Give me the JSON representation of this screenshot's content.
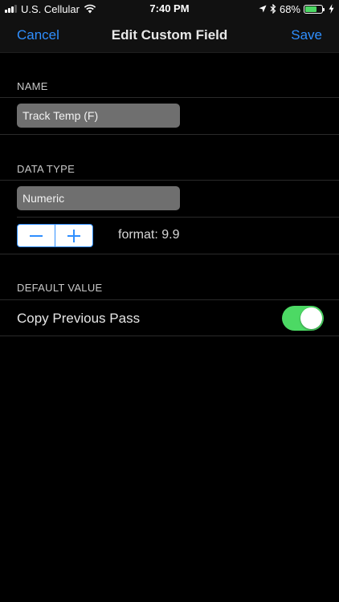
{
  "status_bar": {
    "carrier": "U.S. Cellular",
    "time": "7:40 PM",
    "battery_percent": "68%",
    "battery_level": 0.68,
    "icons": [
      "signal-icon",
      "wifi-icon",
      "location-arrow-icon",
      "bluetooth-icon",
      "battery-icon",
      "charging-bolt-icon"
    ]
  },
  "nav": {
    "cancel_label": "Cancel",
    "title": "Edit Custom Field",
    "save_label": "Save"
  },
  "name_section": {
    "header": "NAME",
    "field_value": "Track Temp (F)"
  },
  "data_type_section": {
    "header": "DATA TYPE",
    "field_value": "Numeric",
    "stepper": {
      "minus_icon": "minus-icon",
      "plus_icon": "plus-icon"
    },
    "format_label": "format: 9.9"
  },
  "default_value_section": {
    "header": "DEFAULT VALUE",
    "row_label": "Copy Previous Pass",
    "toggle_on": true
  },
  "colors": {
    "accent": "#2f8fff",
    "toggle_on": "#4cd964",
    "field_bg": "#6f6f6f",
    "background": "#000000"
  }
}
